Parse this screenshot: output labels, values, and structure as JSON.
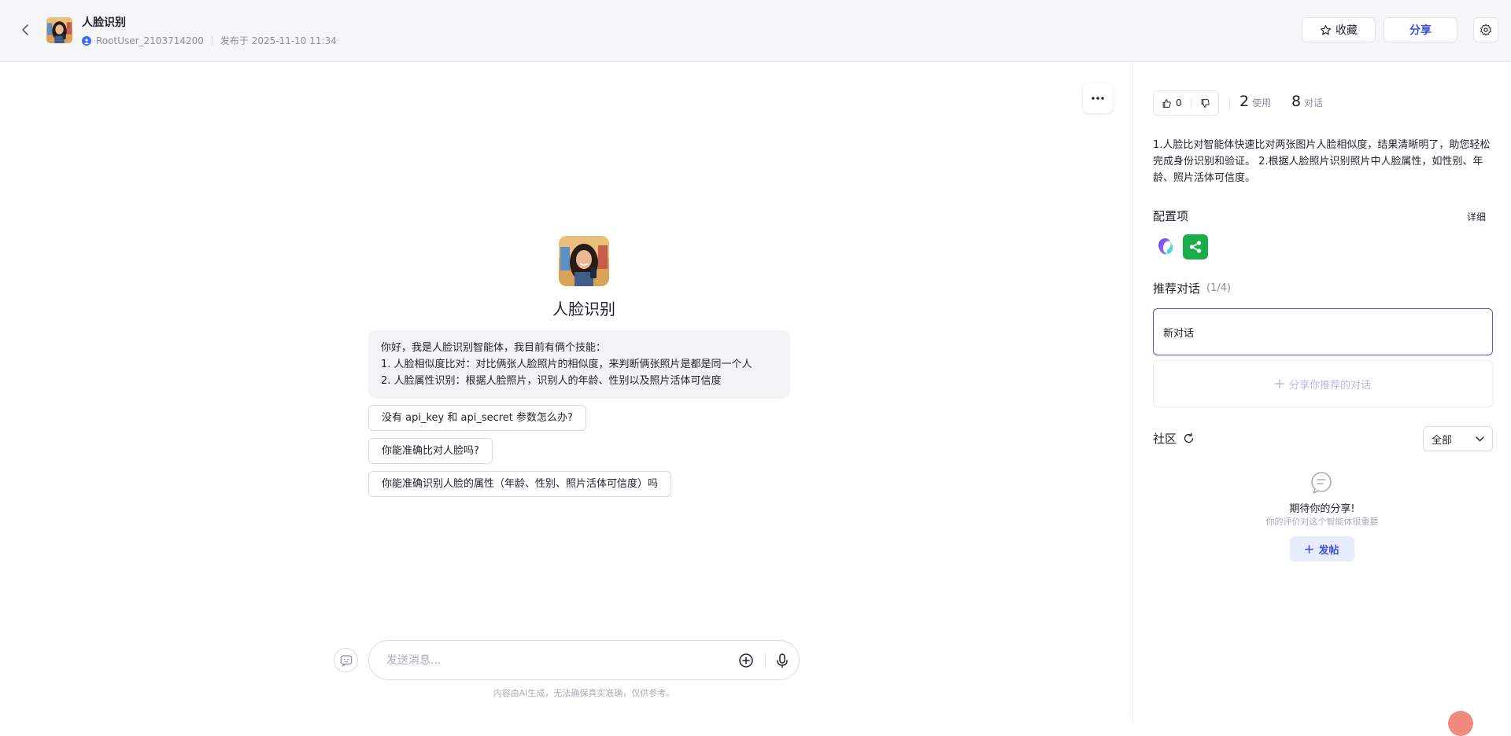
{
  "header": {
    "title": "人脸识别",
    "user": "RootUser_2103714200",
    "published": "发布于 2025-11-10 11:34",
    "favorite_label": "收藏",
    "share_label": "分享"
  },
  "main": {
    "agent_name": "人脸识别",
    "welcome_lines": [
      "你好，我是人脸识别智能体，我目前有俩个技能：",
      "1. 人脸相似度比对：对比俩张人脸照片的相似度，来判断俩张照片是都是同一个人",
      "2. 人脸属性识别：根据人脸照片，识别人的年龄、性别以及照片活体可信度"
    ],
    "suggestions": [
      "没有 api_key 和 api_secret 参数怎么办?",
      "你能准确比对人脸吗?",
      "你能准确识别人脸的属性（年龄、性别、照片活体可信度）吗"
    ],
    "input_placeholder": "发送消息...",
    "disclaimer": "内容由AI生成，无法确保真实准确，仅供参考。"
  },
  "sidebar": {
    "likes": "0",
    "uses": "2",
    "uses_label": "使用",
    "chats": "8",
    "chats_label": "对话",
    "description": "1.人脸比对智能体快速比对两张图片人脸相似度，结果清晰明了，助您轻松完成身份识别和验证。 2.根据人脸照片识别照片中人脸属性，如性别、年龄、照片活体可信度。",
    "config_title": "配置项",
    "detail_label": "详细",
    "recommend_title": "推荐对话",
    "recommend_count": "(1/4)",
    "recommend_item": "新对话",
    "share_recommend": "分享你推荐的对话",
    "community_title": "社区",
    "filter_value": "全部",
    "empty_title": "期待你的分享!",
    "empty_sub": "你的评价对这个智能体很重要",
    "post_label": "发帖"
  },
  "colors": {
    "accent": "#3a4ed6",
    "plugin_green": "#1aad4a",
    "header_bg": "#f5f6f8"
  },
  "icons": [
    "back-icon",
    "star-icon",
    "gear-icon",
    "more-icon",
    "emoji-icon",
    "plus-circle-icon",
    "mic-icon",
    "thumbs-up-icon",
    "thumbs-down-icon",
    "refresh-icon",
    "chevron-down-icon",
    "chat-bubble-icon",
    "plus-icon",
    "share-nodes-icon"
  ]
}
